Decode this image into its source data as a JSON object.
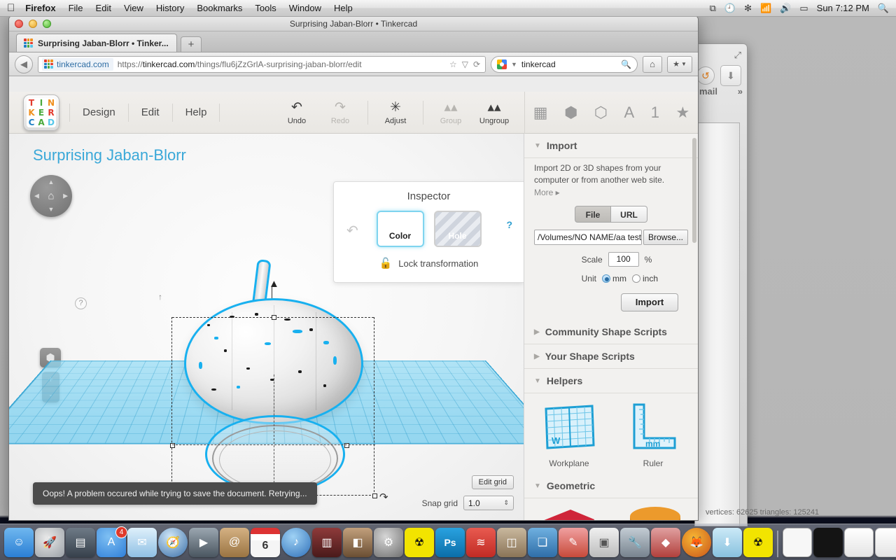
{
  "menubar": {
    "apple": "apple-logo",
    "items": [
      "Firefox",
      "File",
      "Edit",
      "View",
      "History",
      "Bookmarks",
      "Tools",
      "Window",
      "Help"
    ],
    "status_icons": [
      "airplay-icon",
      "timemachine-icon",
      "bluetooth-icon",
      "wifi-icon",
      "volume-icon",
      "battery-icon"
    ],
    "clock": "Sun 7:12 PM",
    "spotlight": "search-icon"
  },
  "browser": {
    "window_title": "Surprising Jaban-Blorr • Tinkercad",
    "tab_title": "Surprising Jaban-Blorr • Tinker...",
    "new_tab": "+",
    "back": "◀",
    "url_host": "tinkercad.com",
    "url_scheme": "https://",
    "url_domain": "tinkercad.com",
    "url_path": "/things/flu6jZzGrlA-surprising-jaban-blorr/edit",
    "url_icons": [
      "bookmark-star-icon",
      "dropdown-icon",
      "reload-icon"
    ],
    "search_value": "tinkercad",
    "search_icon": "search-icon",
    "home_icon": "home-icon",
    "bookmarks_icon": "bookmarks-icon"
  },
  "tinkercad": {
    "logo_letters": [
      {
        "t": "T",
        "c": "#e33b2e"
      },
      {
        "t": "I",
        "c": "#4aa93c"
      },
      {
        "t": "N",
        "c": "#f0901f"
      },
      {
        "t": "K",
        "c": "#f0901f"
      },
      {
        "t": "E",
        "c": "#4aa93c"
      },
      {
        "t": "R",
        "c": "#e33b2e"
      },
      {
        "t": "C",
        "c": "#1e7fc4"
      },
      {
        "t": "A",
        "c": "#4aa93c"
      },
      {
        "t": "D",
        "c": "#56c7ea"
      }
    ],
    "menu": [
      "Design",
      "Edit",
      "Help"
    ],
    "tools": [
      {
        "label": "Undo",
        "icon": "undo-icon",
        "glyph": "↰",
        "enabled": true
      },
      {
        "label": "Redo",
        "icon": "redo-icon",
        "glyph": "↱",
        "enabled": false
      },
      {
        "label": "Adjust",
        "icon": "adjust-icon",
        "glyph": "✎",
        "enabled": true
      },
      {
        "label": "Group",
        "icon": "group-icon",
        "glyph": "▲▲",
        "enabled": false
      },
      {
        "label": "Ungroup",
        "icon": "ungroup-icon",
        "glyph": "▲▲",
        "enabled": true
      }
    ],
    "right_icons": [
      {
        "name": "workplane-icon",
        "glyph": "▦"
      },
      {
        "name": "solid-shape-icon",
        "glyph": "⬢"
      },
      {
        "name": "hole-shape-icon",
        "glyph": "⬡"
      },
      {
        "name": "text-icon",
        "glyph": "A"
      },
      {
        "name": "number-icon",
        "glyph": "1"
      },
      {
        "name": "favorites-icon",
        "glyph": "★"
      }
    ],
    "doc_title": "Surprising Jaban-Blorr",
    "nav": {
      "help": "?",
      "home_icon": "home-icon",
      "up": "▲",
      "down": "▼",
      "left": "◀",
      "right": "▶",
      "cube_icon": "view-cube-icon",
      "zoom_in": "+",
      "zoom_out": "-"
    },
    "inspector": {
      "title": "Inspector",
      "color_label": "Color",
      "hole_label": "Hole",
      "lock_label": "Lock transformation",
      "help": "?",
      "undo_icon": "undo-arrow-icon",
      "lock_icon": "unlocked-padlock-icon"
    },
    "toast": "Oops! A problem occured while trying to save the document. Retrying...",
    "grid": {
      "edit_grid": "Edit grid",
      "snap_label": "Snap grid",
      "snap_value": "1.0",
      "stepper": "⇕"
    },
    "panel": {
      "sections": [
        {
          "name": "import",
          "title": "Import",
          "expanded": true
        },
        {
          "name": "community-shape-scripts",
          "title": "Community Shape Scripts",
          "expanded": false
        },
        {
          "name": "your-shape-scripts",
          "title": "Your Shape Scripts",
          "expanded": false
        },
        {
          "name": "helpers",
          "title": "Helpers",
          "expanded": true
        },
        {
          "name": "geometric",
          "title": "Geometric",
          "expanded": true
        }
      ],
      "import": {
        "description": "Import 2D or 3D shapes from your computer or from another web site.",
        "more": "More ▸",
        "tab_file": "File",
        "tab_url": "URL",
        "file_path": "/Volumes/NO NAME/aa test",
        "browse": "Browse...",
        "scale_label": "Scale",
        "scale_value": "100",
        "percent": "%",
        "unit_label": "Unit",
        "unit_mm": "mm",
        "unit_inch": "inch",
        "unit_selected": "mm",
        "import_button": "Import"
      },
      "helpers": [
        {
          "label": "Workplane",
          "icon": "workplane-helper-icon",
          "mark": "W"
        },
        {
          "label": "Ruler",
          "icon": "ruler-helper-icon",
          "mark": "mm"
        }
      ],
      "geometric": [
        {
          "name": "box-shape",
          "color": "#c42035"
        },
        {
          "name": "cylinder-shape",
          "color": "#e08a20"
        }
      ]
    },
    "expanded_tri": "▼",
    "collapsed_tri": "▶"
  },
  "background_window": {
    "mail_label": "mail",
    "chevron": "»",
    "expand_icon": "expand-icon",
    "reload_icon": "reload-icon",
    "download_icon": "download-icon"
  },
  "status_line": "vertices: 62625 triangles: 125241",
  "dock": {
    "items": [
      {
        "name": "finder",
        "color": "#2b7fd4",
        "glyph": "☺"
      },
      {
        "name": "launchpad",
        "color": "#9aa0a6",
        "glyph": "🚀"
      },
      {
        "name": "mission-control",
        "color": "#4a4a4a",
        "glyph": "▤"
      },
      {
        "name": "app-store",
        "color": "#2f7fd8",
        "glyph": "A",
        "badge": "4"
      },
      {
        "name": "mail",
        "color": "#7fb4e0",
        "glyph": "✉"
      },
      {
        "name": "safari",
        "color": "#3a6fa8",
        "glyph": "🧭"
      },
      {
        "name": "facetime",
        "color": "#5d6a74",
        "glyph": "▶"
      },
      {
        "name": "contacts",
        "color": "#b08b55",
        "glyph": "@"
      },
      {
        "name": "calendar",
        "color": "#ffffff",
        "glyph": "6"
      },
      {
        "name": "itunes",
        "color": "#4b8fd0",
        "glyph": "♪"
      },
      {
        "name": "imovie",
        "color": "#6e3030",
        "glyph": "▥"
      },
      {
        "name": "iphoto",
        "color": "#8a6a4a",
        "glyph": "◧"
      },
      {
        "name": "system-preferences",
        "color": "#8a8a8a",
        "glyph": "⚙"
      },
      {
        "name": "replicatorg",
        "color": "#f2e400",
        "glyph": "☢"
      },
      {
        "name": "photoshop",
        "color": "#0d7ec4",
        "glyph": "Ps"
      },
      {
        "name": "feed-reader",
        "color": "#d63a33",
        "glyph": "≋"
      },
      {
        "name": "image-viewer",
        "color": "#9e8a72",
        "glyph": "🖼"
      },
      {
        "name": "app-blue",
        "color": "#3f88c5",
        "glyph": "❏"
      },
      {
        "name": "sketch-app",
        "color": "#c74a3a",
        "glyph": "✎"
      },
      {
        "name": "ipod-utility",
        "color": "#cfcfcf",
        "glyph": "▣"
      },
      {
        "name": "utilities",
        "color": "#93a0ac",
        "glyph": "🔧"
      },
      {
        "name": "polyhedron-app",
        "color": "#c0504d",
        "glyph": "◆"
      },
      {
        "name": "firefox",
        "color": "#e07a21",
        "glyph": "🦊"
      },
      {
        "name": "downloads-folder",
        "color": "#9fd0e8",
        "glyph": "⬇"
      },
      {
        "name": "replicatorg-2",
        "color": "#f2e400",
        "glyph": "☢"
      },
      {
        "name": "window-white",
        "color": "#f7f7f7",
        "glyph": ""
      },
      {
        "name": "window-black",
        "color": "#141414",
        "glyph": ""
      },
      {
        "name": "document-1",
        "color": "#efefef",
        "glyph": ""
      },
      {
        "name": "document-2",
        "color": "#efefef",
        "glyph": ""
      },
      {
        "name": "document-3",
        "color": "#f3efc0",
        "glyph": ""
      },
      {
        "name": "document-4",
        "color": "#eeeeee",
        "glyph": ""
      },
      {
        "name": "document-5",
        "color": "#eeeeee",
        "glyph": ""
      },
      {
        "name": "document-6",
        "color": "#e8e8e8",
        "glyph": ""
      },
      {
        "name": "document-7",
        "color": "#e8e8e8",
        "glyph": ""
      },
      {
        "name": "document-8",
        "color": "#ededed",
        "glyph": ""
      },
      {
        "name": "trash",
        "color": "#cfd8de",
        "glyph": "🗑"
      }
    ]
  }
}
